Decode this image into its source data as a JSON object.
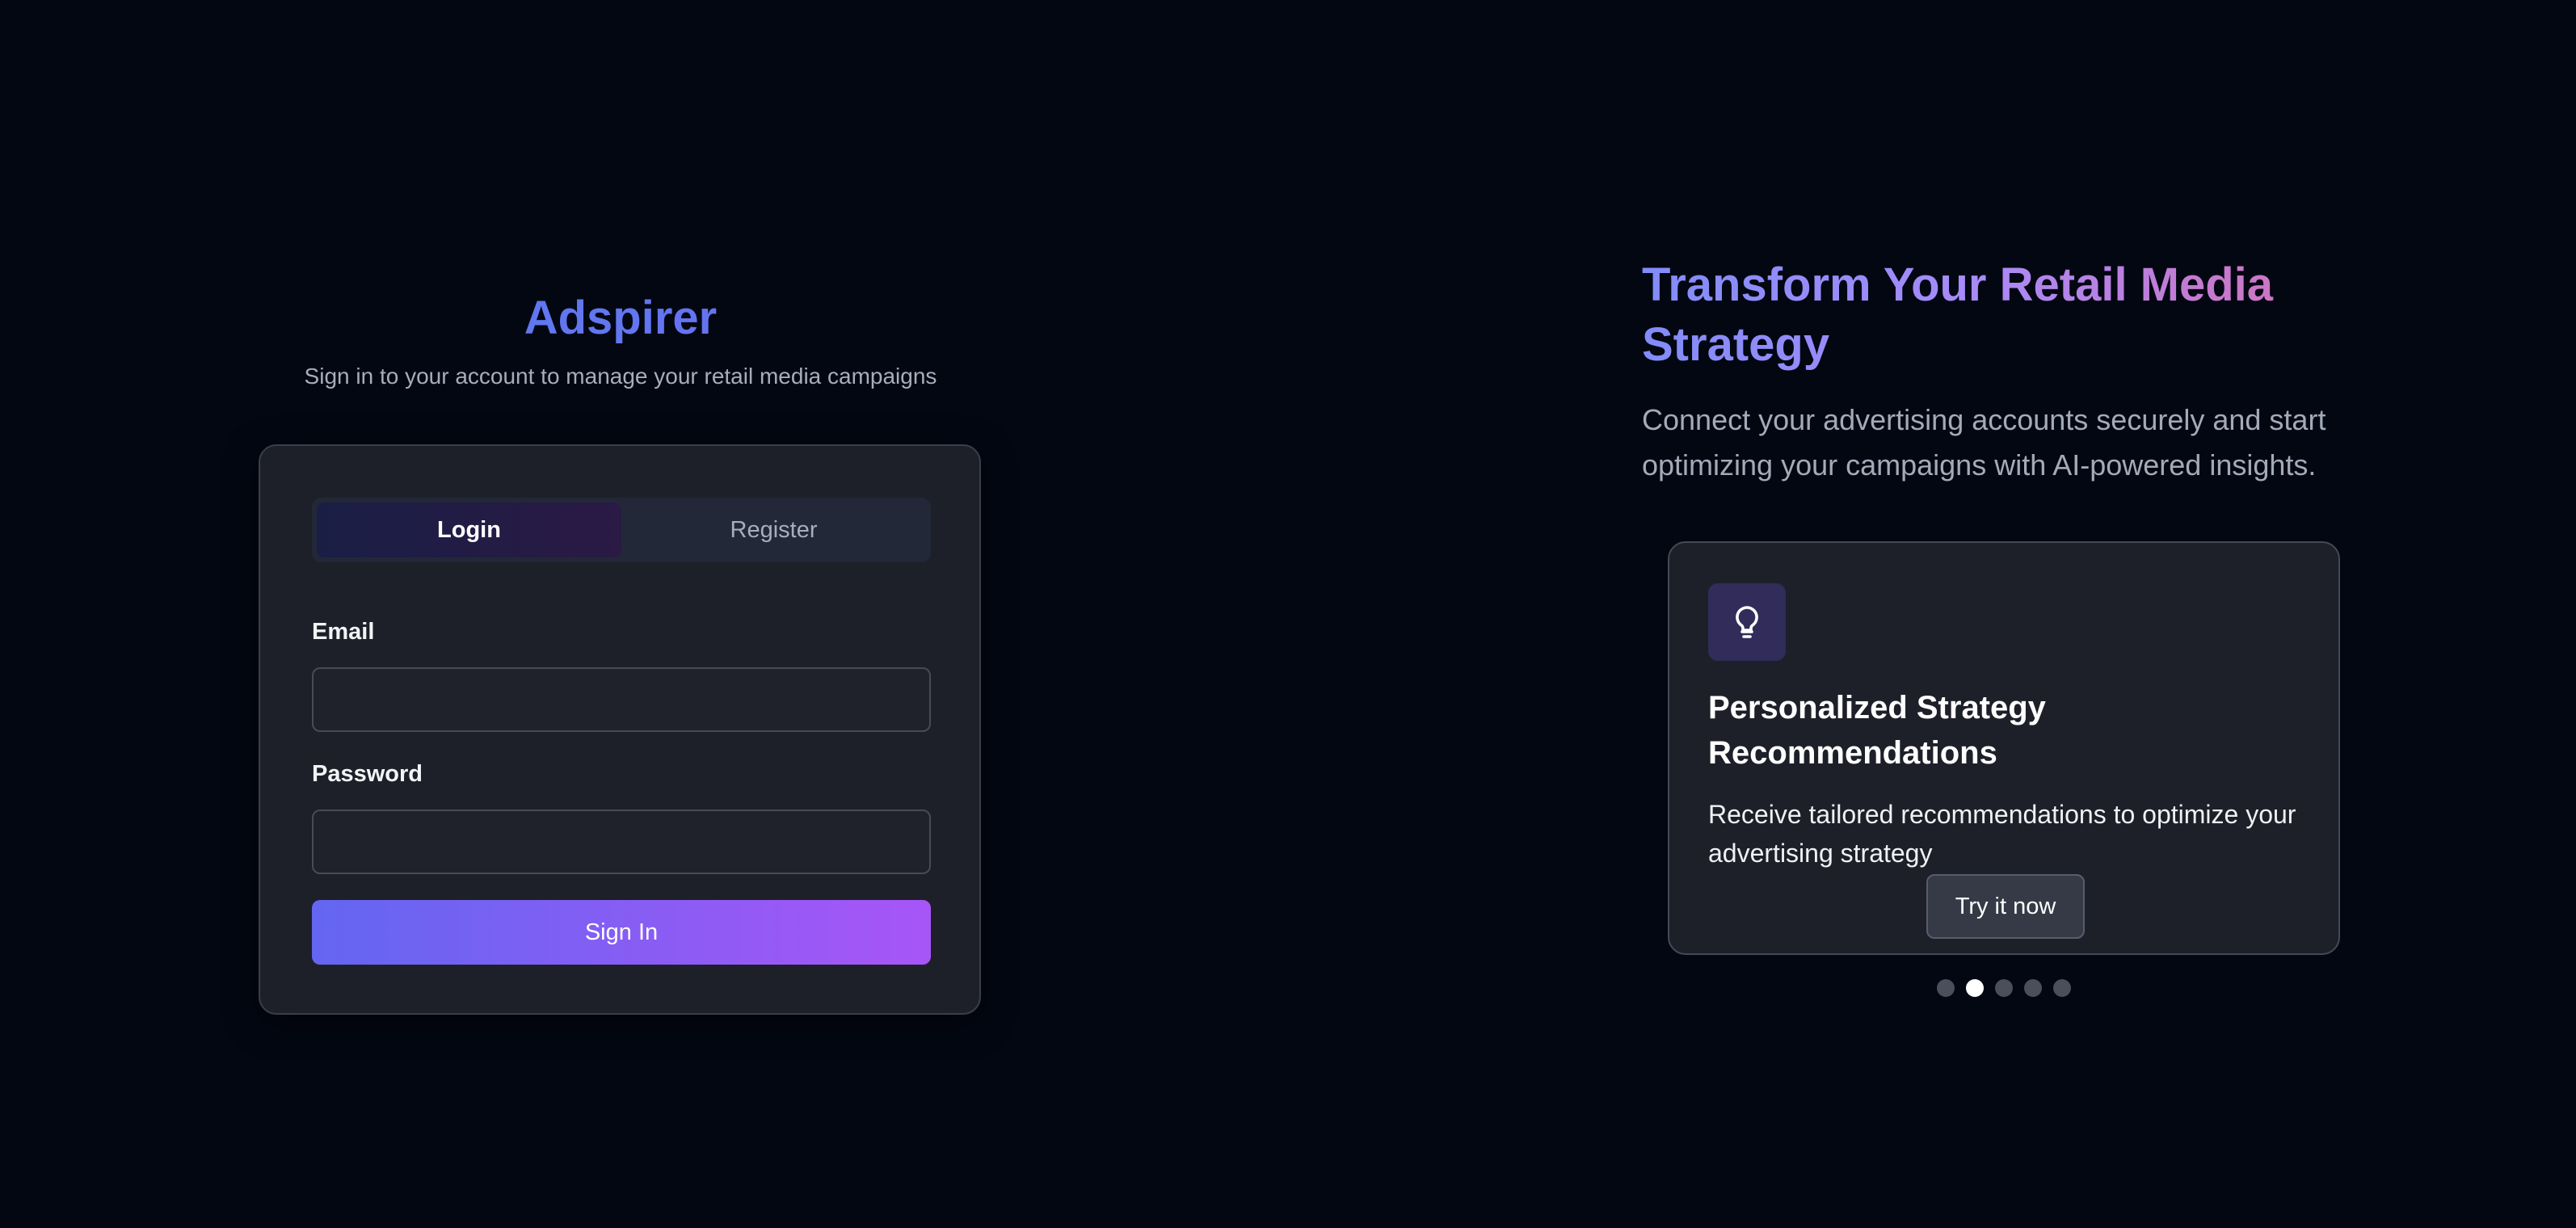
{
  "brand": {
    "name": "Adspirer",
    "subtitle": "Sign in to your account to manage your retail media campaigns"
  },
  "auth": {
    "tabs": [
      {
        "label": "Login",
        "active": true
      },
      {
        "label": "Register",
        "active": false
      }
    ],
    "email_label": "Email",
    "email_value": "",
    "email_placeholder": "",
    "password_label": "Password",
    "password_value": "",
    "password_placeholder": "",
    "submit_label": "Sign In"
  },
  "hero": {
    "headline": "Transform Your Retail Media Strategy",
    "lead": "Connect your advertising accounts securely and start optimizing your campaigns with AI-powered insights."
  },
  "carousel": {
    "card": {
      "icon": "lightbulb-icon",
      "title": "Personalized Strategy Recommendations",
      "description": "Receive tailored recommendations to optimize your advertising strategy",
      "cta_label": "Try it now"
    },
    "total_slides": 5,
    "active_index": 1
  },
  "colors": {
    "background": "#030712",
    "card": "#1e2029",
    "accent_start": "#6366f1",
    "accent_end": "#a855f7",
    "brand": "#5b7cf0"
  }
}
